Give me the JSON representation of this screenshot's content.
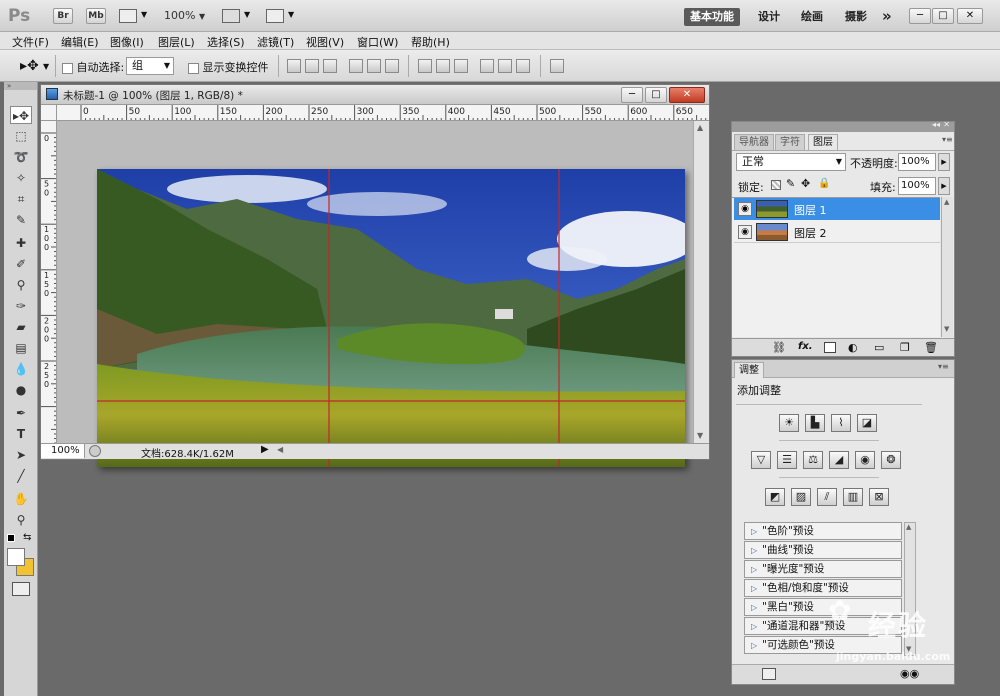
{
  "appbar": {
    "logo": "Ps",
    "bridge_label": "Br",
    "minibridge_label": "Mb",
    "zoom": "100%",
    "workspaces": [
      "基本功能",
      "设计",
      "绘画",
      "摄影"
    ],
    "more": "»"
  },
  "menus": [
    "文件(F)",
    "编辑(E)",
    "图像(I)",
    "图层(L)",
    "选择(S)",
    "滤镜(T)",
    "视图(V)",
    "窗口(W)",
    "帮助(H)"
  ],
  "options": {
    "auto_select_label": "自动选择:",
    "auto_select_value": "组",
    "transform_label": "显示变换控件"
  },
  "document": {
    "title": "未标题-1 @ 100% (图层 1, RGB/8) *",
    "ruler_top": [
      "0",
      "50",
      "100",
      "150",
      "200",
      "250",
      "300",
      "350",
      "400",
      "450",
      "500",
      "550",
      "600",
      "650"
    ],
    "ruler_left": [
      "0",
      "5 0",
      "1 0 0",
      "1 5 0",
      "2 0 0",
      "2 5 0"
    ],
    "zoom": "100%",
    "doc_info": "文档:628.4K/1.62M"
  },
  "layers_panel": {
    "tabs": [
      "导航器",
      "字符",
      "图层"
    ],
    "active_tab": "图层",
    "blend_mode": "正常",
    "opacity_label": "不透明度:",
    "opacity": "100%",
    "lock_label": "锁定:",
    "fill_label": "填充:",
    "fill": "100%",
    "layers": [
      {
        "name": "图层 1",
        "selected": true
      },
      {
        "name": "图层 2",
        "selected": false
      }
    ],
    "bottom_icons": [
      "link-icon",
      "fx-icon",
      "mask-icon",
      "adjustment-icon",
      "folder-icon",
      "new-layer-icon",
      "trash-icon"
    ],
    "fx_label": "fx."
  },
  "adjustments_panel": {
    "tab": "调整",
    "heading": "添加调整",
    "presets": [
      "\"色阶\"预设",
      "\"曲线\"预设",
      "\"曝光度\"预设",
      "\"色相/饱和度\"预设",
      "\"黑白\"预设",
      "\"通道混和器\"预设",
      "\"可选颜色\"预设"
    ]
  },
  "watermark": {
    "brand": "经验",
    "url": "jingyan.baidu.com"
  },
  "colors": {
    "workspace_active": "#5a5a5a",
    "selected_layer": "#3a8ee6",
    "guide": "#c0282a",
    "close_button": "#c23b23"
  }
}
